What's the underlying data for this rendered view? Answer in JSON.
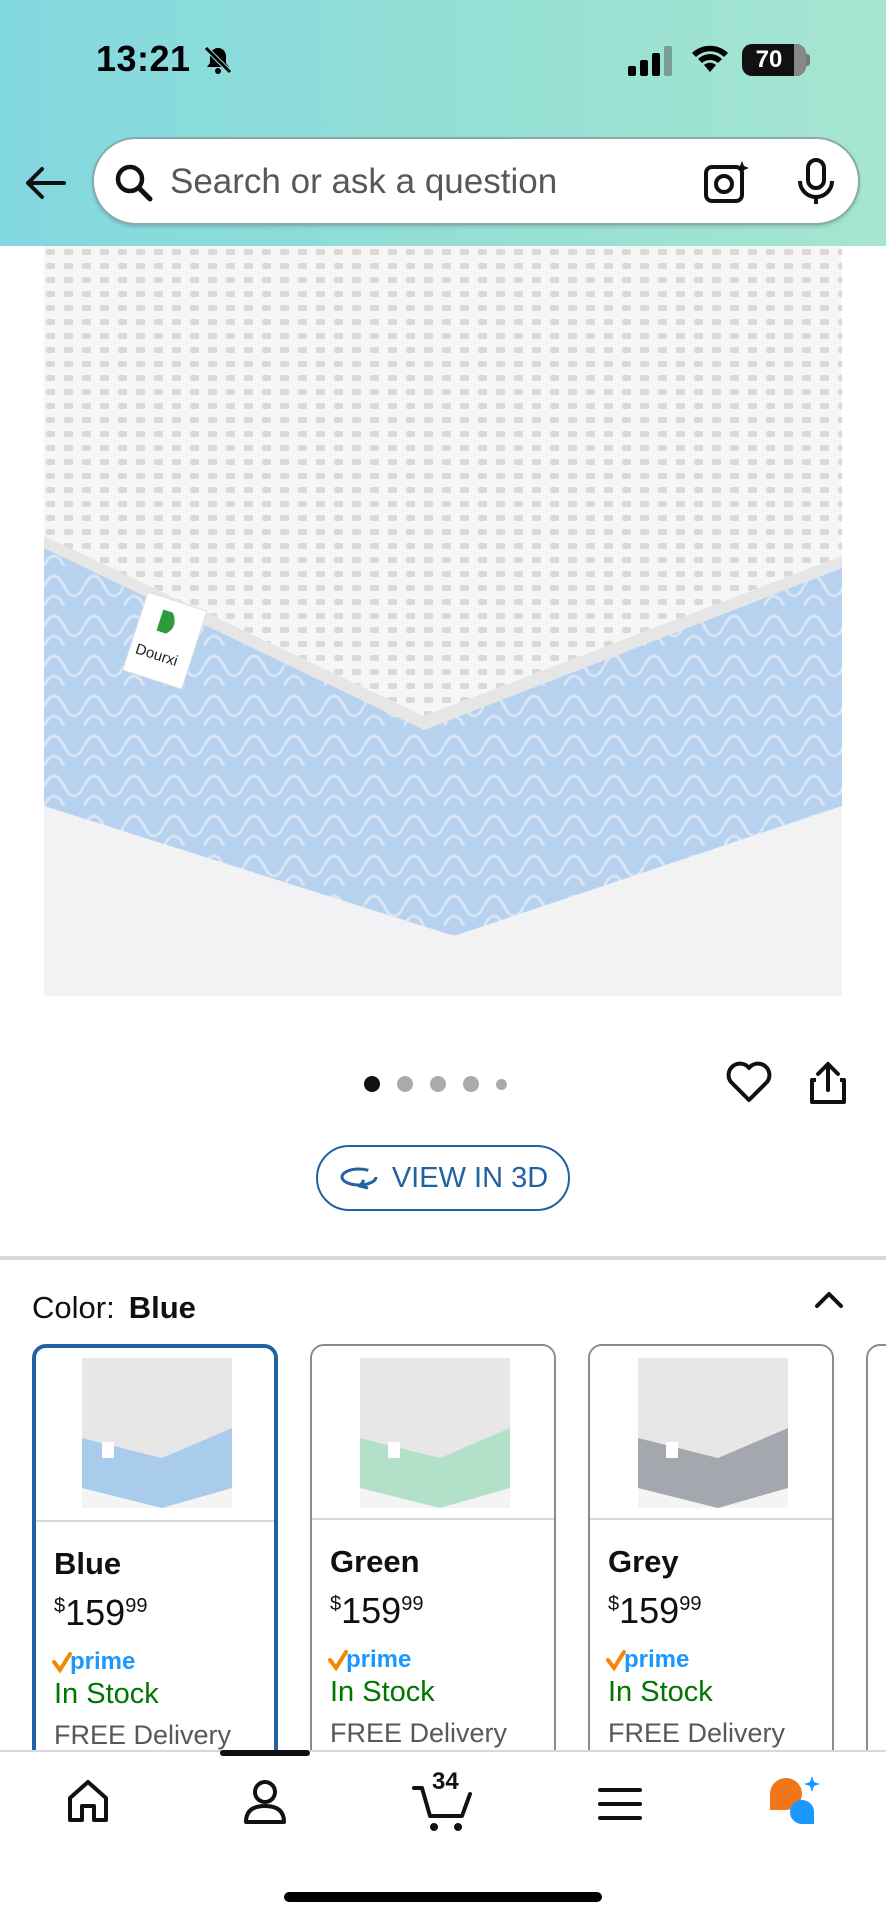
{
  "status_bar": {
    "time": "13:21",
    "battery": "70"
  },
  "search": {
    "placeholder": "Search or ask a question"
  },
  "product": {
    "brand_label": "Dourxi",
    "image_count": 5,
    "active_image": 1
  },
  "actions": {
    "view_3d_label": "VIEW IN 3D"
  },
  "color_selector": {
    "label": "Color:",
    "selected": "Blue",
    "options": [
      {
        "name": "Blue",
        "currency": "$",
        "price_whole": "159",
        "price_fraction": "99",
        "prime": "prime",
        "stock": "In Stock",
        "delivery": "FREE Delivery",
        "accent": "#a9cbec"
      },
      {
        "name": "Green",
        "currency": "$",
        "price_whole": "159",
        "price_fraction": "99",
        "prime": "prime",
        "stock": "In Stock",
        "delivery": "FREE Delivery",
        "accent": "#b3e0c9"
      },
      {
        "name": "Grey",
        "currency": "$",
        "price_whole": "159",
        "price_fraction": "99",
        "prime": "prime",
        "stock": "In Stock",
        "delivery": "FREE Delivery",
        "accent": "#a4a7ad"
      }
    ]
  },
  "bottom_nav": {
    "cart_count": "34"
  },
  "colors": {
    "link_blue": "#2162a1",
    "stock_green": "#007600",
    "prime_orange": "#f08804",
    "prime_blue": "#1a98ff"
  }
}
